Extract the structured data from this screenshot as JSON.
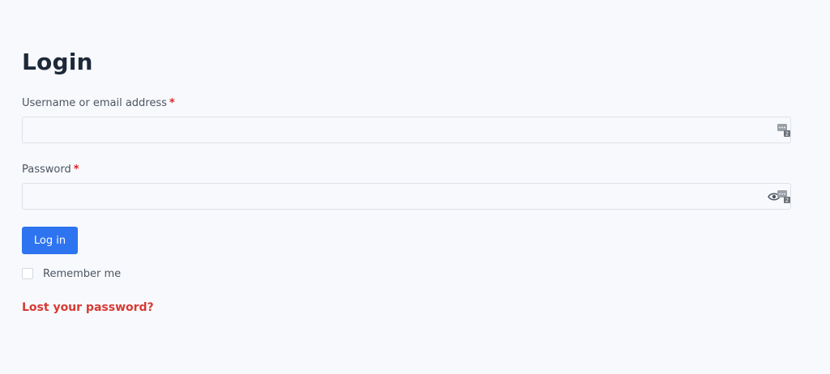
{
  "page": {
    "title": "Login"
  },
  "form": {
    "username": {
      "label": "Username or email address",
      "required_marker": "*",
      "value": "",
      "password_manager_badge": "2"
    },
    "password": {
      "label": "Password",
      "required_marker": "*",
      "value": "",
      "password_manager_badge": "2"
    },
    "submit_label": "Log in",
    "remember_me_label": "Remember me",
    "remember_me_checked": false,
    "lost_password_label": "Lost your password?"
  },
  "colors": {
    "background": "#f8f9fc",
    "title": "#1d2939",
    "required": "#e02424",
    "button": "#2e73f0",
    "link": "#d83a34"
  },
  "icons": {
    "password_manager": "password-manager-icon",
    "show_password": "eye-icon"
  }
}
